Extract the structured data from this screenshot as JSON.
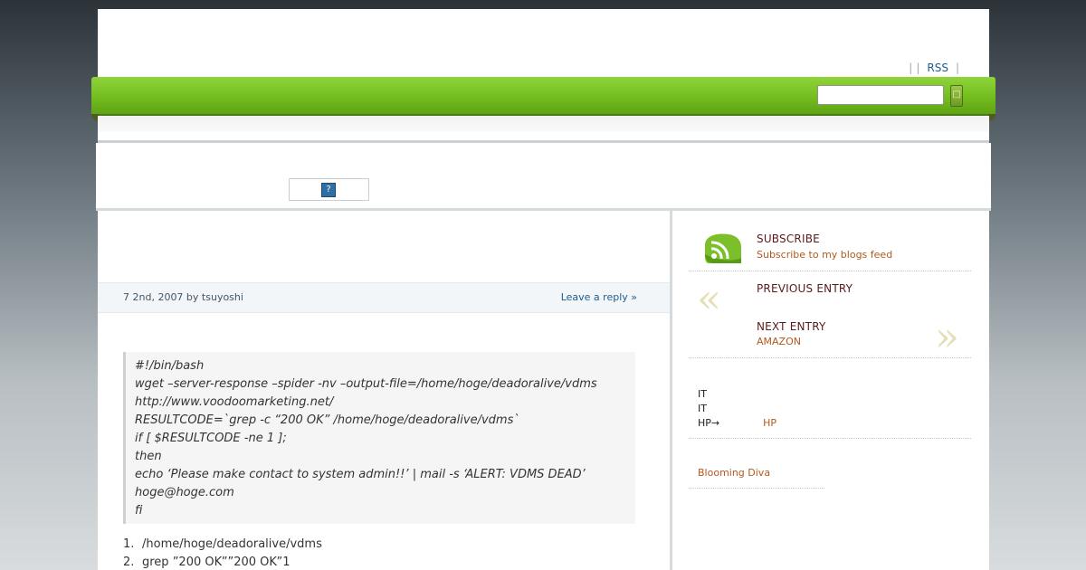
{
  "header": {
    "links": [
      "RSS"
    ]
  },
  "search": {
    "placeholder": "",
    "button_label": "□"
  },
  "banner": {
    "ad_icon": "?"
  },
  "post": {
    "date_prefix": "7 2nd, 2007 by ",
    "author": "tsuyoshi",
    "reply_link": "Leave a reply »",
    "code_lines": [
      "#!/bin/bash",
      "wget –server-response –spider -nv –output-file=/home/hoge/deadoralive/vdms",
      "http://www.voodoomarketing.net/",
      "RESULTCODE=`grep -c “200 OK” /home/hoge/deadoralive/vdms`",
      "if [ $RESULTCODE -ne 1 ];",
      "then",
      "echo ‘Please make contact to system admin!!’ | mail -s ‘ALERT: VDMS DEAD’",
      "hoge@hoge.com",
      "fi"
    ],
    "steps": [
      {
        "num": "1.",
        "text": "/home/hoge/deadoralive/vdms"
      },
      {
        "num": "2.",
        "text": "grep ”200 OK””200 OK”1"
      }
    ]
  },
  "sidebar": {
    "subscribe": {
      "title": "SUBSCRIBE",
      "subtitle": "Subscribe to my blogs feed",
      "icon": "rss-icon"
    },
    "previous": {
      "title": "PREVIOUS ENTRY",
      "quote": "«"
    },
    "next": {
      "title": "NEXT ENTRY",
      "link": "AMAZON",
      "quote": "»"
    },
    "tags": {
      "line1": "IT",
      "line2": "IT",
      "line3_prefix": "HP→",
      "line3_link": "HP"
    },
    "blogroll": {
      "link": "Blooming Diva"
    }
  },
  "colors": {
    "nav_green": "#74bd1f",
    "link_blue": "#1f5c8a",
    "link_orange": "#b25a1d",
    "title_maroon": "#5a1a1a"
  }
}
